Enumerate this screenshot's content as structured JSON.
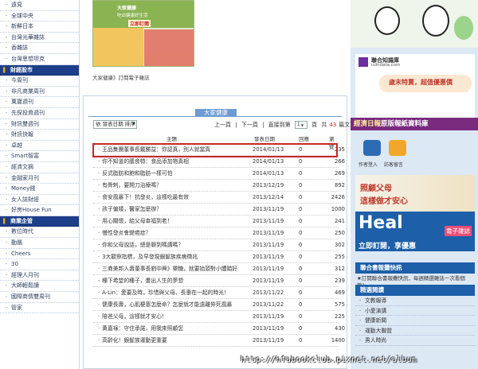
{
  "left_nav": [
    {
      "label": "遠見",
      "type": "item"
    },
    {
      "label": "全球中央",
      "type": "item"
    },
    {
      "label": "新鮮日本",
      "type": "item"
    },
    {
      "label": "台灣光華雜誌",
      "type": "item"
    },
    {
      "label": "香雜誌",
      "type": "item"
    },
    {
      "label": "台灣思想坦克",
      "type": "item"
    },
    {
      "label": "財經股市",
      "type": "section"
    },
    {
      "label": "今周刊",
      "type": "item"
    },
    {
      "label": "非凡商業周刊",
      "type": "item"
    },
    {
      "label": "萬寶週刊",
      "type": "item"
    },
    {
      "label": "先探投資週刊",
      "type": "item"
    },
    {
      "label": "財訊雙週刊",
      "type": "item"
    },
    {
      "label": "財訊快報",
      "type": "item"
    },
    {
      "label": "卓越",
      "type": "item"
    },
    {
      "label": "Smart智富",
      "type": "item"
    },
    {
      "label": "經濟文摘",
      "type": "item"
    },
    {
      "label": "金融家月刊",
      "type": "item"
    },
    {
      "label": "Money錢",
      "type": "item"
    },
    {
      "label": "女人誌財經",
      "type": "item"
    },
    {
      "label": "好房House Fun",
      "type": "item"
    },
    {
      "label": "商業企管",
      "type": "section"
    },
    {
      "label": "數位時代",
      "type": "item"
    },
    {
      "label": "動腦",
      "type": "item"
    },
    {
      "label": "Cheers",
      "type": "item"
    },
    {
      "label": "30",
      "type": "item"
    },
    {
      "label": "經理人月刊",
      "type": "item"
    },
    {
      "label": "大師輕鬆讀",
      "type": "item"
    },
    {
      "label": "國際商情雙周刊",
      "type": "item"
    },
    {
      "label": "管家",
      "type": "item"
    }
  ],
  "promo": {
    "line1": "大家健康",
    "line2": "吃出健康好生活",
    "line3": "立即訂閱"
  },
  "subscribe_caption": "大家健康》訂閱電子雜誌",
  "panel": {
    "title": "大家健康",
    "sort_select": "依 發表日期 排序",
    "pager": {
      "prev": "上一頁",
      "next": "下一頁",
      "goto": "直接到第",
      "page": "1",
      "page_unit": "頁",
      "total_prefix": "共",
      "total": "43",
      "total_suffix": "篇文章"
    },
    "headers": {
      "title": "主題",
      "date": "發表日期",
      "replies": "回應",
      "views": "瀏覽"
    },
    "rows": [
      {
        "title": "王品集團董事長戴勝益：你認真，別人就當真",
        "date": "2014/01/13",
        "replies": "0",
        "views": "235"
      },
      {
        "title": "你不知道的膳食特：食品添加物真相",
        "date": "2014/01/13",
        "replies": "0",
        "views": "266"
      },
      {
        "title": "反式脂肪和飽和脂肪一樣可怕",
        "date": "2014/01/13",
        "replies": "0",
        "views": "269"
      },
      {
        "title": "有骨刺，要開刀治療嗎？",
        "date": "2013/12/19",
        "replies": "0",
        "views": "892"
      },
      {
        "title": "食安風暴下！抗發炎，這樣吃最有效",
        "date": "2013/12/14",
        "replies": "0",
        "views": "2426"
      },
      {
        "title": "孩子偏矮，醫家怎麼辦？",
        "date": "2013/11/19",
        "replies": "0",
        "views": "1000"
      },
      {
        "title": "用心關懷，給父母幸福到老！",
        "date": "2013/11/19",
        "replies": "0",
        "views": "241"
      },
      {
        "title": "慢性發炎會變癌症？",
        "date": "2013/11/19",
        "replies": "0",
        "views": "250"
      },
      {
        "title": "你和父母說話，總是聊到嗎講嗎？",
        "date": "2013/11/19",
        "replies": "0",
        "views": "302"
      },
      {
        "title": "3大觀察指標，及早發現銀髮族疾病徵兆",
        "date": "2013/11/19",
        "replies": "0",
        "views": "255"
      },
      {
        "title": "三商美邦人壽董事長劉中興》樂糖，就要抬頭對小體踏好",
        "date": "2013/11/19",
        "replies": "0",
        "views": "312"
      },
      {
        "title": "種下希望的種子，畫出人生的夢想",
        "date": "2013/11/19",
        "replies": "0",
        "views": "239"
      },
      {
        "title": "A-Lin：愛要及時，珍惜與父母、長輩在一起的時光！",
        "date": "2013/11/22",
        "replies": "0",
        "views": "469"
      },
      {
        "title": "健康長壽，心肌梗塞怎麼命？怎麼就才能遠離猝死風暴",
        "date": "2013/11/22",
        "replies": "0",
        "views": "575"
      },
      {
        "title": "陪爸父母，這樣就才安心！",
        "date": "2013/11/19",
        "replies": "0",
        "views": "225"
      },
      {
        "title": "黃嘉祿：守住承諾，用我來照顧您",
        "date": "2013/11/19",
        "replies": "0",
        "views": "430"
      },
      {
        "title": "高齡化！銀髮族運動更重要",
        "date": "2013/11/19",
        "replies": "0",
        "views": "1400"
      }
    ]
  },
  "right": {
    "udn_title": "聯合知識庫",
    "udn_url": "udndata.com",
    "udn_promo": "歲末特賣，超值優惠價",
    "udn_band_a": "經濟日報",
    "udn_band_b": "原版報紙資料庫",
    "icon1_label": "作者登入",
    "icon2_label": "訪客留言",
    "ad1_line1": "照顧父母",
    "ad1_line2": "這樣做才安心",
    "ad2_big": "Heal",
    "ad2_small": "電子雜誌",
    "ad2_cta": "立即訂閱，享優惠",
    "section1": "聯合書報攤快訊",
    "section1_text": "★訂閱聯合書報攤快訊，每週精選雜誌一次看個夠！",
    "section2": "精選閱讀",
    "list": [
      "文教報導",
      "小愛演講",
      "健康新聞",
      "運動大聯盟",
      "男人時尚"
    ]
  },
  "watermark": "http://hfabookclub.pixnet.net/album"
}
